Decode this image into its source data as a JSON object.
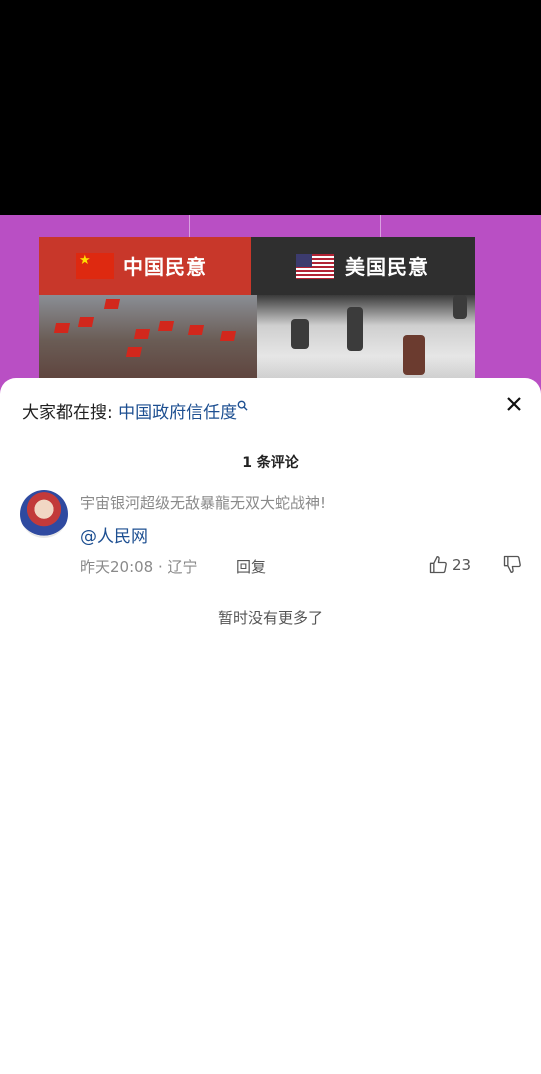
{
  "banner": {
    "left_title": "中国民意",
    "right_title": "美国民意"
  },
  "sheet": {
    "search_prefix": "大家都在搜: ",
    "search_term": "中国政府信任度",
    "comment_count": "1 条评论",
    "comment": {
      "text": "宇宙银河超级无敌暴龍无双大蛇战神!",
      "mention": "@人民网",
      "meta": "昨天20:08 · 辽宁",
      "reply_label": "回复",
      "likes": "23"
    },
    "footer": "暂时没有更多了"
  },
  "colors": {
    "accent_link": "#1d4f91",
    "video_bg_purple": "#b94fc4"
  },
  "icons": [
    "search-icon",
    "close-icon",
    "thumb-up-icon",
    "thumb-down-icon"
  ]
}
